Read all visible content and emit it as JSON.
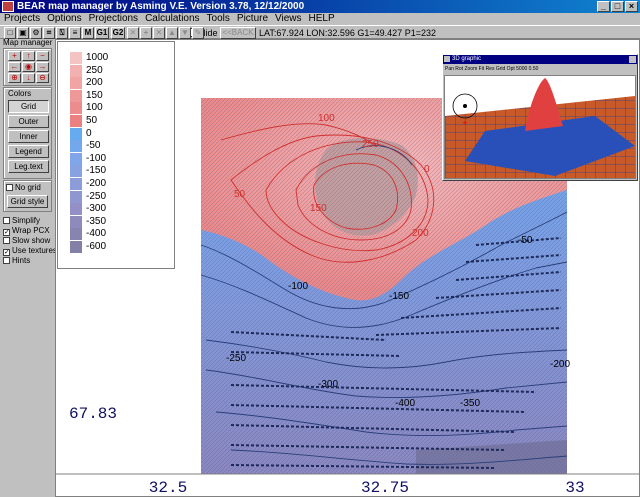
{
  "window": {
    "title": "BEAR map manager by Asming V.E. Version 3.78, 12/12/2000"
  },
  "menu": [
    {
      "label": "Projects"
    },
    {
      "label": "Options"
    },
    {
      "label": "Projections"
    },
    {
      "label": "Calculations"
    },
    {
      "label": "Tools"
    },
    {
      "label": "Picture"
    },
    {
      "label": "Views"
    },
    {
      "label": "HELP"
    }
  ],
  "toolbar": {
    "buttons": [
      {
        "label": "□",
        "icon": "open-icon",
        "enabled": true
      },
      {
        "label": "▣",
        "icon": "save-icon",
        "enabled": true
      },
      {
        "label": "⚙",
        "icon": "settings-icon",
        "enabled": true
      },
      {
        "label": "⌗",
        "icon": "crosshair-icon",
        "enabled": true
      },
      {
        "label": "⍂",
        "icon": "print-icon",
        "enabled": true
      },
      {
        "label": "≡",
        "icon": "list-icon",
        "enabled": true
      },
      {
        "label": "M",
        "icon": "",
        "enabled": true
      },
      {
        "label": "G1",
        "icon": "",
        "enabled": true
      },
      {
        "label": "G2",
        "icon": "",
        "enabled": true
      },
      {
        "label": "✕",
        "icon": "close-icon",
        "enabled": false
      },
      {
        "label": "+",
        "icon": "add-icon",
        "enabled": false
      },
      {
        "label": "✕",
        "icon": "delete-icon",
        "enabled": false
      },
      {
        "label": "▲",
        "icon": "up-icon",
        "enabled": false
      },
      {
        "label": "▼",
        "icon": "down-icon",
        "enabled": false
      },
      {
        "label": "✎",
        "icon": "pencil-icon",
        "enabled": false
      }
    ],
    "hide_label": "Hide",
    "back_label": "<<BACK",
    "status": "LAT:67.924  LON:32.596  G1=49.427  P1=232"
  },
  "panel": {
    "title": "Map manager",
    "nav_buttons": [
      {
        "icon": "zoom-in-icon",
        "glyph": "+"
      },
      {
        "icon": "arrow-up-icon",
        "glyph": "↑"
      },
      {
        "icon": "zoom-out-icon",
        "glyph": "−"
      },
      {
        "icon": "arrow-left-icon",
        "glyph": "←"
      },
      {
        "icon": "center-icon",
        "glyph": "◉"
      },
      {
        "icon": "arrow-right-icon",
        "glyph": "→"
      },
      {
        "icon": "magnify-plus-icon",
        "glyph": "⊕"
      },
      {
        "icon": "arrow-down-icon",
        "glyph": "↓"
      },
      {
        "icon": "magnify-minus-icon",
        "glyph": "⊖"
      }
    ],
    "colors_title": "Colors",
    "buttons": [
      {
        "label": "Grid",
        "active": true
      },
      {
        "label": "Outer",
        "active": false
      },
      {
        "label": "Inner",
        "active": false
      },
      {
        "label": "Legend",
        "active": false
      },
      {
        "label": "Leg.text",
        "active": false
      }
    ],
    "no_grid_label": "No grid",
    "no_grid_checked": false,
    "grid_style_label": "Grid style",
    "options": [
      {
        "label": "Simplify",
        "checked": false
      },
      {
        "label": "Wrap PCX",
        "checked": true
      },
      {
        "label": "Slow show",
        "checked": false
      },
      {
        "label": "Use textures",
        "checked": true
      },
      {
        "label": "Hints",
        "checked": false
      }
    ]
  },
  "legend": {
    "entries": [
      {
        "label": "1000",
        "color": "#f4c4c4"
      },
      {
        "label": "250",
        "color": "#f2b0b0"
      },
      {
        "label": "200",
        "color": "#f0a4a4"
      },
      {
        "label": "150",
        "color": "#ee9898"
      },
      {
        "label": "100",
        "color": "#ec8c8c"
      },
      {
        "label": "50",
        "color": "#ea8080"
      },
      {
        "label": "0",
        "color": "#66aaf0"
      },
      {
        "label": "-50",
        "color": "#74a8ec"
      },
      {
        "label": "-100",
        "color": "#7ea6e8"
      },
      {
        "label": "-150",
        "color": "#86a2e0"
      },
      {
        "label": "-200",
        "color": "#8c9cd8"
      },
      {
        "label": "-250",
        "color": "#9096cf"
      },
      {
        "label": "-300",
        "color": "#9290c6"
      },
      {
        "label": "-350",
        "color": "#8e8abc"
      },
      {
        "label": "-400",
        "color": "#8884b0"
      },
      {
        "label": "-600",
        "color": "#8280a6"
      }
    ]
  },
  "map": {
    "contour_labels": [
      "100",
      "250",
      "0",
      "50",
      "150",
      "200",
      "-50",
      "-100",
      "-150",
      "-250",
      "-200",
      "-300",
      "-400",
      "-350"
    ],
    "lat_labels": [
      "67.83"
    ],
    "lon_labels": [
      "32.5",
      "32.75",
      "33"
    ],
    "colors": {
      "positive": "#ec8c8c",
      "negative": "#7ea6e8",
      "deep": "#8e8abc",
      "contour": "#2a3f7a",
      "contour_pos": "#d03030",
      "axis_text": "#101060"
    }
  },
  "overview": {
    "title": "3D graphic",
    "tools": "Pan  Rot  Zoom  Fit  Res  Grid  Opt  5000  0.50"
  }
}
